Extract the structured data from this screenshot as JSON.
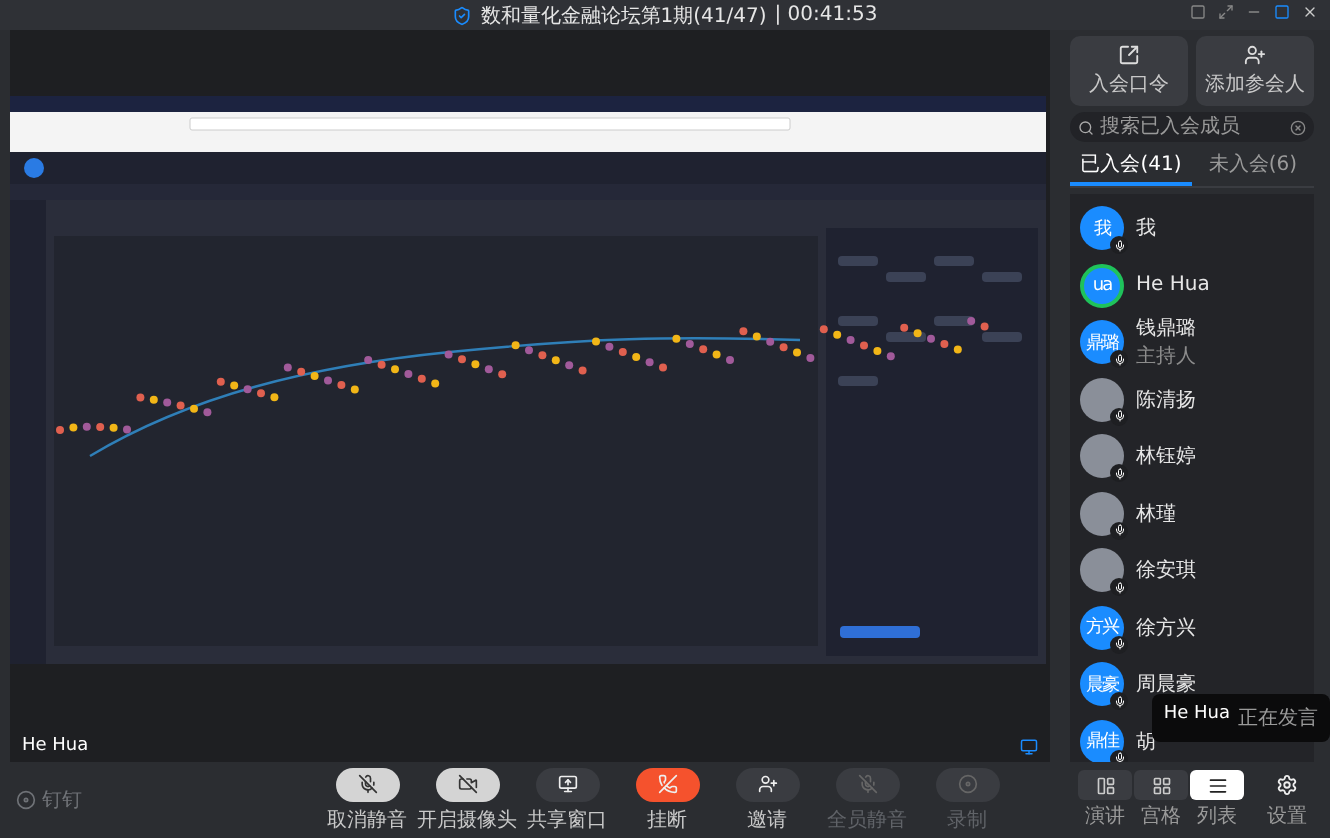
{
  "window": {
    "title": "数和量化金融论坛第1期(41/47)",
    "timer": "| 00:41:53"
  },
  "stage": {
    "speaker": "He Hua"
  },
  "panel": {
    "actions": [
      {
        "label": "入会口令",
        "kind": "passcode"
      },
      {
        "label": "添加参会人",
        "kind": "add"
      }
    ],
    "search": {
      "placeholder": "搜索已入会成员"
    },
    "tabs": [
      {
        "label": "已入会(41)",
        "selected": true
      },
      {
        "label": "未入会(6)",
        "selected": false
      }
    ],
    "participants": [
      {
        "name": "我",
        "kind": "initials",
        "avatar": "我",
        "speaking": false
      },
      {
        "name": "He Hua",
        "kind": "initials",
        "avatar": "ua",
        "speaking": true
      },
      {
        "name": "钱鼎璐",
        "kind": "initials",
        "avatar": "鼎璐",
        "role": "主持人",
        "speaking": false
      },
      {
        "name": "陈清扬",
        "kind": "photo",
        "speaking": false
      },
      {
        "name": "林钰婷",
        "kind": "photo",
        "speaking": false
      },
      {
        "name": "林瑾",
        "kind": "photo",
        "speaking": false
      },
      {
        "name": "徐安琪",
        "kind": "photo",
        "speaking": false
      },
      {
        "name": "徐方兴",
        "kind": "initials",
        "avatar": "方兴",
        "speaking": false
      },
      {
        "name": "周晨豪",
        "kind": "initials",
        "avatar": "晨豪",
        "speaking": false
      },
      {
        "name": "胡",
        "kind": "initials",
        "avatar": "鼎佳",
        "speaking": false
      }
    ],
    "tooltip": {
      "name": "He Hua",
      "text": "正在发言"
    }
  },
  "toolbar": {
    "brand": "钉钉",
    "buttons": [
      {
        "label": "取消静音",
        "kind": "mic-off",
        "disabled": false
      },
      {
        "label": "开启摄像头",
        "kind": "camera-off",
        "disabled": false
      },
      {
        "label": "共享窗口",
        "kind": "share",
        "disabled": false
      },
      {
        "label": "挂断",
        "kind": "hangup",
        "disabled": false
      },
      {
        "label": "邀请",
        "kind": "invite",
        "disabled": false
      },
      {
        "label": "全员静音",
        "kind": "mute-all",
        "disabled": true
      },
      {
        "label": "录制",
        "kind": "record",
        "disabled": true
      }
    ],
    "views": [
      {
        "label": "演讲",
        "kind": "speaker",
        "selected": false
      },
      {
        "label": "宫格",
        "kind": "grid",
        "selected": false
      },
      {
        "label": "列表",
        "kind": "list",
        "selected": true
      }
    ],
    "settings": {
      "label": "设置"
    }
  }
}
